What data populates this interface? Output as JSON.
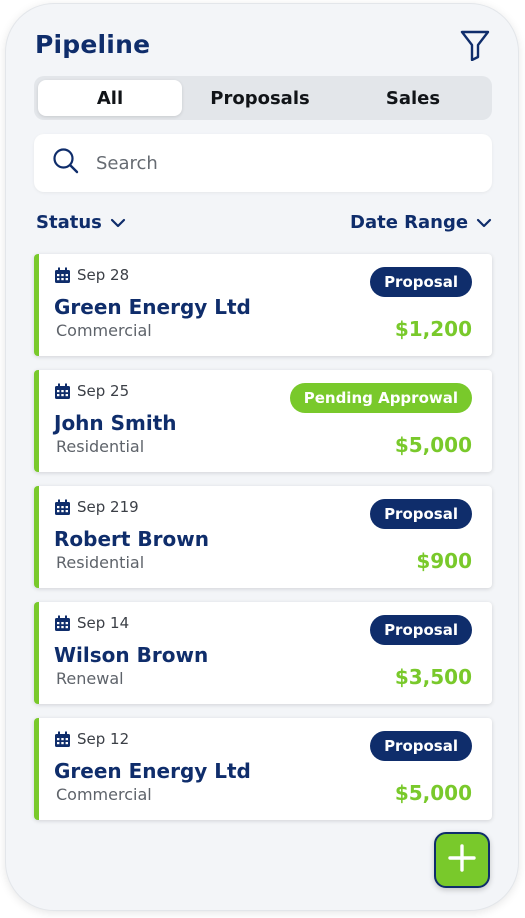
{
  "header": {
    "title": "Pipeline",
    "filter_icon": "filter-icon"
  },
  "tabs": [
    {
      "label": "All",
      "active": true
    },
    {
      "label": "Proposals",
      "active": false
    },
    {
      "label": "Sales",
      "active": false
    }
  ],
  "search": {
    "placeholder": "Search",
    "value": "",
    "icon": "search-icon"
  },
  "filters": {
    "status_label": "Status",
    "date_range_label": "Date Range"
  },
  "colors": {
    "navy": "#0f2d6b",
    "green": "#79c92b",
    "background": "#f3f5f8"
  },
  "deals": [
    {
      "date": "Sep 28",
      "name": "Green Energy Ltd",
      "type": "Commercial",
      "status": "Proposal",
      "amount": "$1,200"
    },
    {
      "date": "Sep 25",
      "name": "John Smith",
      "type": "Residential",
      "status": "Pending Approwal",
      "amount": "$5,000"
    },
    {
      "date": "Sep 219",
      "name": "Robert Brown",
      "type": "Residential",
      "status": "Proposal",
      "amount": "$900"
    },
    {
      "date": "Sep 14",
      "name": "Wilson Brown",
      "type": "Renewal",
      "status": "Proposal",
      "amount": "$3,500"
    },
    {
      "date": "Sep 12",
      "name": "Green Energy Ltd",
      "type": "Commercial",
      "status": "Proposal",
      "amount": "$5,000"
    }
  ],
  "fab": {
    "icon": "plus-icon"
  }
}
